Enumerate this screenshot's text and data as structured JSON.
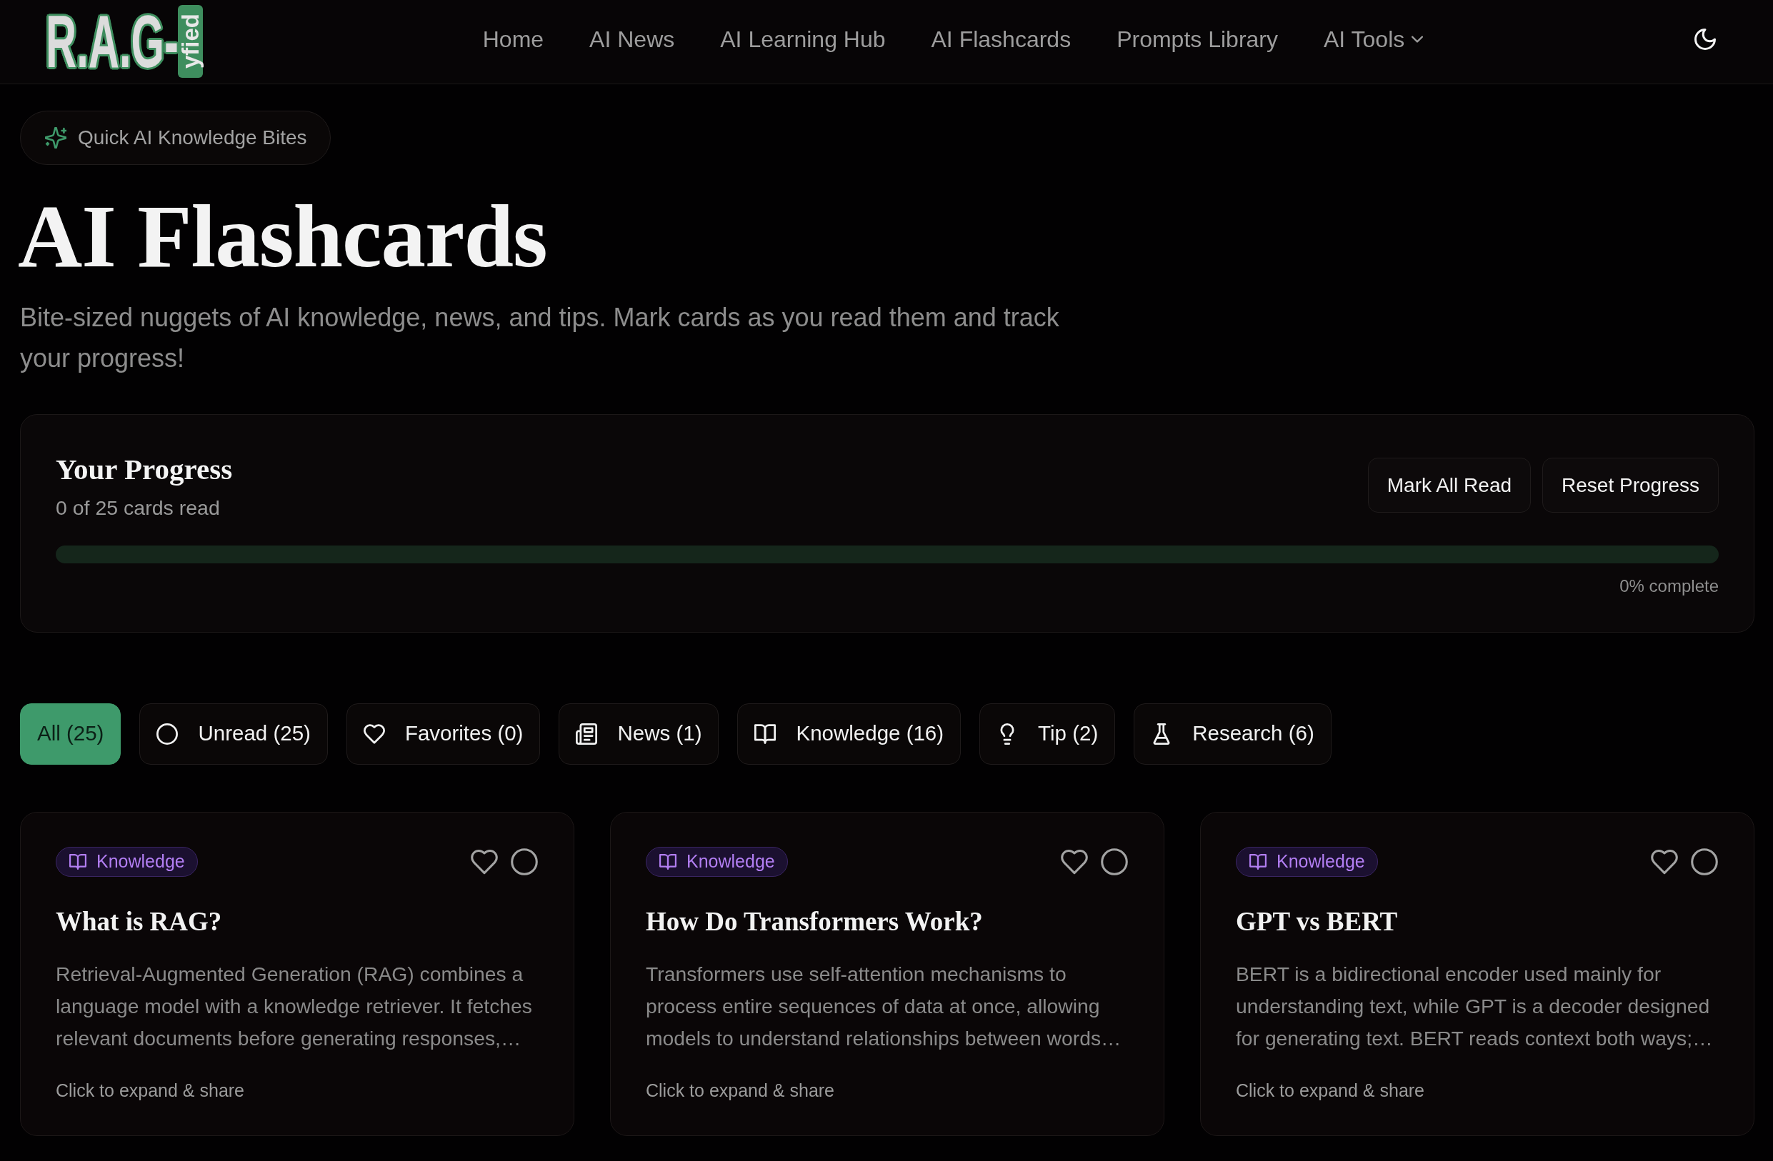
{
  "logo": {
    "text": "R.A.G-",
    "tag": "yfied"
  },
  "nav": [
    {
      "label": "Home",
      "kind": "link"
    },
    {
      "label": "AI News",
      "kind": "link"
    },
    {
      "label": "AI Learning Hub",
      "kind": "link"
    },
    {
      "label": "AI Flashcards",
      "kind": "link"
    },
    {
      "label": "Prompts Library",
      "kind": "link"
    },
    {
      "label": "AI Tools",
      "kind": "dropdown"
    }
  ],
  "hero": {
    "badge": "Quick AI Knowledge Bites",
    "title": "AI Flashcards",
    "subtitle": "Bite-sized nuggets of AI knowledge, news, and tips. Mark cards as you read them and track your progress!"
  },
  "progress": {
    "title": "Your Progress",
    "summary": "0 of 25 cards read",
    "buttons": [
      "Mark All Read",
      "Reset Progress"
    ],
    "level": 0,
    "reading": "0% complete"
  },
  "filters": [
    {
      "label": "All (25)",
      "kind": "all",
      "selected": true
    },
    {
      "label": "Unread (25)",
      "kind": "unread",
      "selected": false
    },
    {
      "label": "Favorites (0)",
      "kind": "favorites",
      "selected": false
    },
    {
      "label": "News (1)",
      "kind": "news",
      "selected": false
    },
    {
      "label": "Knowledge (16)",
      "kind": "knowledge",
      "selected": false
    },
    {
      "label": "Tip (2)",
      "kind": "tip",
      "selected": false
    },
    {
      "label": "Research (6)",
      "kind": "research",
      "selected": false
    }
  ],
  "cards": [
    {
      "tag": "Knowledge",
      "kind": "knowledge",
      "favorite": false,
      "read": false,
      "title": "What is RAG?",
      "text": "Retrieval-Augmented Generation (RAG) combines a language model with a knowledge retriever. It fetches relevant documents before generating responses,…",
      "footer": "Click to expand & share"
    },
    {
      "tag": "Knowledge",
      "kind": "knowledge",
      "favorite": false,
      "read": false,
      "title": "How Do Transformers Work?",
      "text": "Transformers use self-attention mechanisms to process entire sequences of data at once, allowing models to understand relationships between words…",
      "footer": "Click to expand & share"
    },
    {
      "tag": "Knowledge",
      "kind": "knowledge",
      "favorite": false,
      "read": false,
      "title": "GPT vs BERT",
      "text": "BERT is a bidirectional encoder used mainly for understanding text, while GPT is a decoder designed for generating text. BERT reads context both ways;…",
      "footer": "Click to expand & share"
    }
  ]
}
